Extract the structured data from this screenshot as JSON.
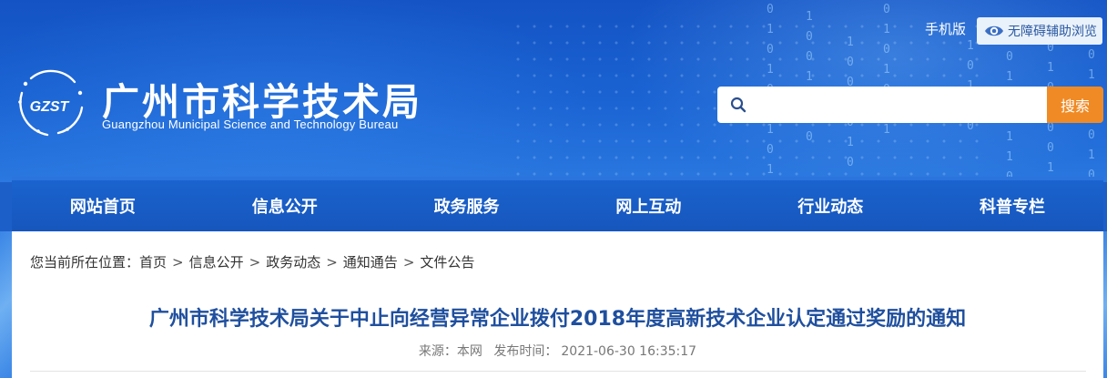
{
  "header": {
    "logo_text": "GZST",
    "site_title": "广州市科学技术局",
    "site_subtitle": "Guangzhou Municipal Science and Technology Bureau",
    "mobile_label": "手机版",
    "accessibility_label": "无障碍辅助浏览",
    "search": {
      "placeholder": "",
      "button_label": "搜索",
      "icon": "search-icon"
    },
    "colors": {
      "banner": "#1a63d3",
      "search_button": "#f08a24"
    }
  },
  "nav": {
    "items": [
      {
        "label": "网站首页"
      },
      {
        "label": "信息公开"
      },
      {
        "label": "政务服务"
      },
      {
        "label": "网上互动"
      },
      {
        "label": "行业动态"
      },
      {
        "label": "科普专栏"
      }
    ]
  },
  "breadcrumb": {
    "prefix": "您当前所在位置：",
    "items": [
      "首页",
      "信息公开",
      "政务动态",
      "通知通告",
      "文件公告"
    ],
    "separator": ">"
  },
  "article": {
    "title": "广州市科学技术局关于中止向经营异常企业拨付2018年度高新技术企业认定通过奖励的通知",
    "source_label": "来源：本网",
    "time_label": "发布时间：",
    "time_value": "2021-06-30 16:35:17",
    "title_color": "#1f4f9e"
  }
}
